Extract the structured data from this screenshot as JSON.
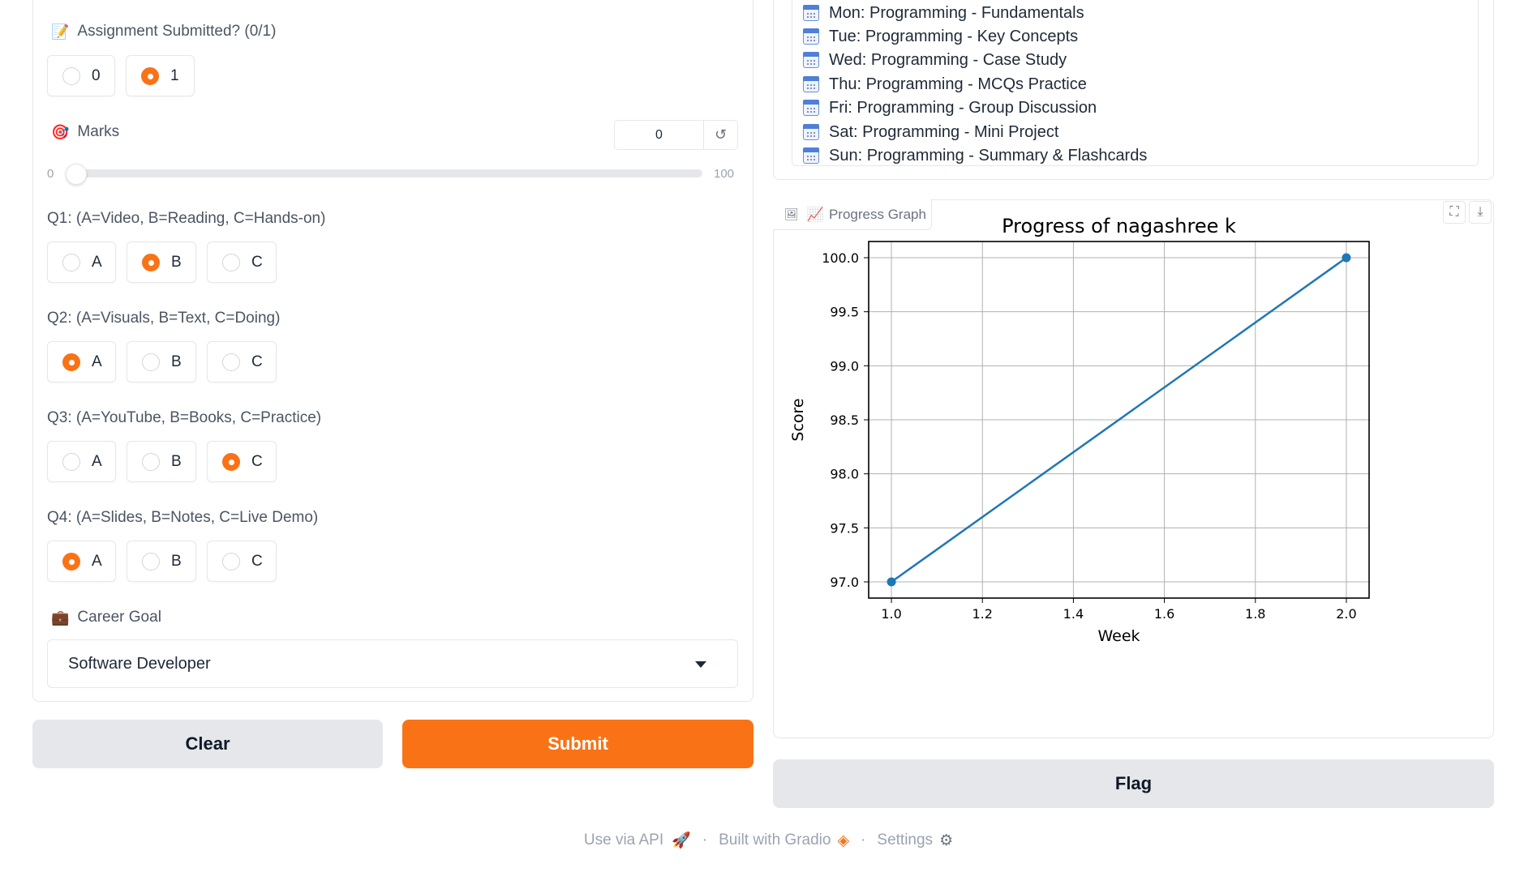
{
  "schedule": {
    "items": [
      "Mon: Programming - Fundamentals",
      "Tue: Programming - Key Concepts",
      "Wed: Programming - Case Study",
      "Thu: Programming - MCQs Practice",
      "Fri: Programming - Group Discussion",
      "Sat: Programming - Mini Project",
      "Sun: Programming - Summary & Flashcards"
    ]
  },
  "assignment": {
    "label": "Assignment Submitted? (0/1)",
    "icon": "memo-icon",
    "options": [
      "0",
      "1"
    ],
    "selected": "1"
  },
  "marks": {
    "label": "Marks",
    "icon": "target-icon",
    "value": "0",
    "min": "0",
    "max": "100",
    "reset_glyph": "↺"
  },
  "questions": [
    {
      "label": "Q1: (A=Video, B=Reading, C=Hands-on)",
      "options": [
        "A",
        "B",
        "C"
      ],
      "selected": "B"
    },
    {
      "label": "Q2: (A=Visuals, B=Text, C=Doing)",
      "options": [
        "A",
        "B",
        "C"
      ],
      "selected": "A"
    },
    {
      "label": "Q3: (A=YouTube, B=Books, C=Practice)",
      "options": [
        "A",
        "B",
        "C"
      ],
      "selected": "C"
    },
    {
      "label": "Q4: (A=Slides, B=Notes, C=Live Demo)",
      "options": [
        "A",
        "B",
        "C"
      ],
      "selected": "A"
    }
  ],
  "career": {
    "label": "Career Goal",
    "icon": "briefcase-icon",
    "value": "Software Developer"
  },
  "buttons": {
    "clear": "Clear",
    "submit": "Submit",
    "flag": "Flag"
  },
  "graph": {
    "tab_label": "Progress Graph",
    "icon": "chart-increasing-icon"
  },
  "chart_data": {
    "type": "line",
    "title": "Progress of nagashree k",
    "xlabel": "Week",
    "ylabel": "Score",
    "x": [
      1.0,
      2.0
    ],
    "series": [
      {
        "values": [
          97.0,
          100.0
        ]
      }
    ],
    "xlim": [
      0.95,
      2.05
    ],
    "ylim": [
      96.85,
      100.15
    ],
    "xticks": [
      "1.0",
      "1.2",
      "1.4",
      "1.6",
      "1.8",
      "2.0"
    ],
    "yticks": [
      "97.0",
      "97.5",
      "98.0",
      "98.5",
      "99.0",
      "99.5",
      "100.0"
    ],
    "grid": true,
    "line_color": "#1f77b4"
  },
  "footer": {
    "api": "Use via API",
    "built": "Built with Gradio",
    "settings": "Settings"
  },
  "colors": {
    "accent": "#f97316",
    "border": "#e5e7eb"
  }
}
